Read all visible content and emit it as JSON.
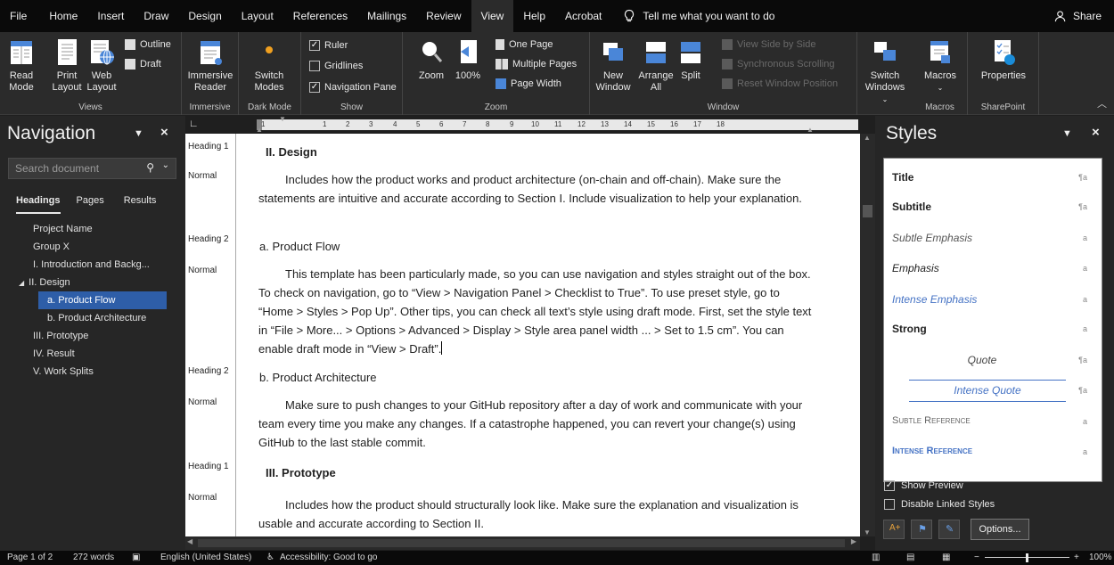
{
  "tabs": [
    "File",
    "Home",
    "Insert",
    "Draw",
    "Design",
    "Layout",
    "References",
    "Mailings",
    "Review",
    "View",
    "Help",
    "Acrobat"
  ],
  "tell_me": "Tell me what you want to do",
  "share": "Share",
  "ribbon": {
    "views": {
      "label": "Views",
      "read_mode": "Read Mode",
      "print_layout": "Print Layout",
      "web_layout": "Web Layout",
      "outline": "Outline",
      "draft": "Draft"
    },
    "immersive": {
      "label": "Immersive",
      "reader": "Immersive Reader"
    },
    "dark_mode": {
      "label": "Dark Mode",
      "switch_modes": "Switch Modes"
    },
    "show": {
      "label": "Show",
      "ruler": "Ruler",
      "gridlines": "Gridlines",
      "navigation_pane": "Navigation Pane"
    },
    "zoom": {
      "label": "Zoom",
      "zoom": "Zoom",
      "hundred": "100%",
      "one_page": "One Page",
      "multiple_pages": "Multiple Pages",
      "page_width": "Page Width"
    },
    "window": {
      "label": "Window",
      "new_window": "New Window",
      "arrange_all": "Arrange All",
      "split": "Split",
      "side_by_side": "View Side by Side",
      "sync_scroll": "Synchronous Scrolling",
      "reset_position": "Reset Window Position",
      "switch_windows": "Switch Windows"
    },
    "macros": {
      "label": "Macros",
      "macros": "Macros"
    },
    "sharepoint": {
      "label": "SharePoint",
      "properties": "Properties"
    }
  },
  "navigation": {
    "title": "Navigation",
    "search_placeholder": "Search document",
    "tabs": [
      "Headings",
      "Pages",
      "Results"
    ],
    "items": [
      "Project Name",
      "Group X",
      "I. Introduction and Backg...",
      "II. Design",
      "a. Product Flow",
      "b. Product Architecture",
      "III. Prototype",
      "IV. Result",
      "V. Work Splits"
    ]
  },
  "ruler": {
    "numbers": [
      "1",
      "1",
      "2",
      "3",
      "4",
      "5",
      "6",
      "7",
      "8",
      "9",
      "10",
      "11",
      "12",
      "13",
      "14",
      "15",
      "16",
      "17",
      "18"
    ]
  },
  "style_area": [
    "Heading 1",
    "Normal",
    "Heading 2",
    "Normal",
    "Heading 2",
    "Normal",
    "Heading 1",
    "Normal"
  ],
  "document": {
    "h_design": "II.  Design",
    "p_design": "Includes how the product works and product architecture (on-chain and off-chain). Make sure the statements are intuitive and accurate according to Section I. Include visualization to help your explanation.",
    "h_flow": "a.   Product Flow",
    "p_flow": "This template has been particularly made, so you can use navigation and styles straight out of the box. To check on navigation, go to “View > Navigation Panel > Checklist to True”. To use preset style, go to “Home > Styles > Pop Up”. Other tips, you can check all text’s style using draft mode. First, set the style text in “File > More... > Options > Advanced > Display > Style area panel width ... > Set to 1.5 cm”. You can enable draft mode in “View > Draft”.",
    "h_arch": "b.   Product Architecture",
    "p_arch": "Make sure to push changes to your GitHub repository after a day of work and communicate with your team every time you make any changes. If a catastrophe happened, you can revert your change(s) using GitHub to the last stable commit.",
    "h_proto": "III.  Prototype",
    "p_proto": "Includes how the product should structurally look like. Make sure the explanation and visualization is usable and accurate according to Section II."
  },
  "styles": {
    "title": "Styles",
    "items": [
      {
        "name": "Title",
        "mark": "¶a"
      },
      {
        "name": "Subtitle",
        "mark": "¶a"
      },
      {
        "name": "Subtle Emphasis",
        "mark": "a"
      },
      {
        "name": "Emphasis",
        "mark": "a"
      },
      {
        "name": "Intense Emphasis",
        "mark": "a"
      },
      {
        "name": "Strong",
        "mark": "a"
      },
      {
        "name": "Quote",
        "mark": "¶a"
      },
      {
        "name": "Intense Quote",
        "mark": "¶a"
      },
      {
        "name": "Subtle Reference",
        "mark": "a"
      },
      {
        "name": "Intense Reference",
        "mark": "a"
      }
    ],
    "show_preview": "Show Preview",
    "disable_linked": "Disable Linked Styles",
    "options": "Options..."
  },
  "status": {
    "page": "Page 1 of 2",
    "words": "272 words",
    "language": "English (United States)",
    "accessibility": "Accessibility: Good to go",
    "zoom": "100%"
  },
  "colors": {
    "accent": "#2e5ea8",
    "ribbon_bg": "#2b2b2b",
    "tab_bg": "#0a0a0a",
    "link_blue": "#4472c4"
  }
}
